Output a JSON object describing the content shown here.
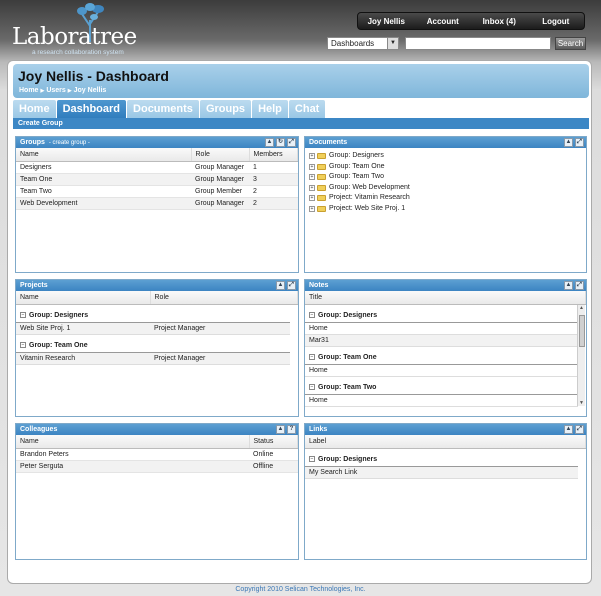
{
  "logo": {
    "wordmark": "Laborat",
    "wordmark_end": "ree",
    "tagline": "a research collaboration system"
  },
  "topnav": {
    "user": "Joy Nellis",
    "account": "Account",
    "inbox": "Inbox (4)",
    "logout": "Logout"
  },
  "search": {
    "scope": "Dashboards",
    "button": "Search",
    "placeholder": ""
  },
  "page": {
    "title": "Joy Nellis - Dashboard",
    "breadcrumb": [
      "Home",
      "Users",
      "Joy Nellis"
    ]
  },
  "tabs": [
    "Home",
    "Dashboard",
    "Documents",
    "Groups",
    "Help",
    "Chat"
  ],
  "active_tab": "Dashboard",
  "subnav": {
    "create_group": "Create Group"
  },
  "groups": {
    "title": "Groups",
    "create_link": "- create group -",
    "columns": [
      "Name",
      "Role",
      "Members"
    ],
    "rows": [
      [
        "Designers",
        "Group Manager",
        "1"
      ],
      [
        "Team One",
        "Group Manager",
        "3"
      ],
      [
        "Team Two",
        "Group Member",
        "2"
      ],
      [
        "Web Development",
        "Group Manager",
        "2"
      ]
    ]
  },
  "documents": {
    "title": "Documents",
    "items": [
      "Group: Designers",
      "Group: Team One",
      "Group: Team Two",
      "Group: Web Development",
      "Project: Vitamin Research",
      "Project: Web Site Proj. 1"
    ]
  },
  "projects": {
    "title": "Projects",
    "columns": [
      "Name",
      "Role"
    ],
    "groups": [
      {
        "label": "Group: Designers",
        "rows": [
          [
            "Web Site Proj. 1",
            "Project Manager"
          ]
        ]
      },
      {
        "label": "Group: Team One",
        "rows": [
          [
            "Vitamin Research",
            "Project Manager"
          ]
        ]
      }
    ]
  },
  "notes": {
    "title": "Notes",
    "column": "Title",
    "groups": [
      {
        "label": "Group: Designers",
        "rows": [
          "Home",
          "Mar31"
        ]
      },
      {
        "label": "Group: Team One",
        "rows": [
          "Home"
        ]
      },
      {
        "label": "Group: Team Two",
        "rows": [
          "Home"
        ]
      }
    ]
  },
  "colleagues": {
    "title": "Colleagues",
    "columns": [
      "Name",
      "Status"
    ],
    "rows": [
      [
        "Brandon Peters",
        "Online"
      ],
      [
        "Peter Serguta",
        "Offline"
      ]
    ]
  },
  "links": {
    "title": "Links",
    "column": "Label",
    "groups": [
      {
        "label": "Group: Designers",
        "rows": [
          "My Search Link"
        ]
      }
    ]
  },
  "footer": "Copyright 2010 Selican Technologies, Inc."
}
